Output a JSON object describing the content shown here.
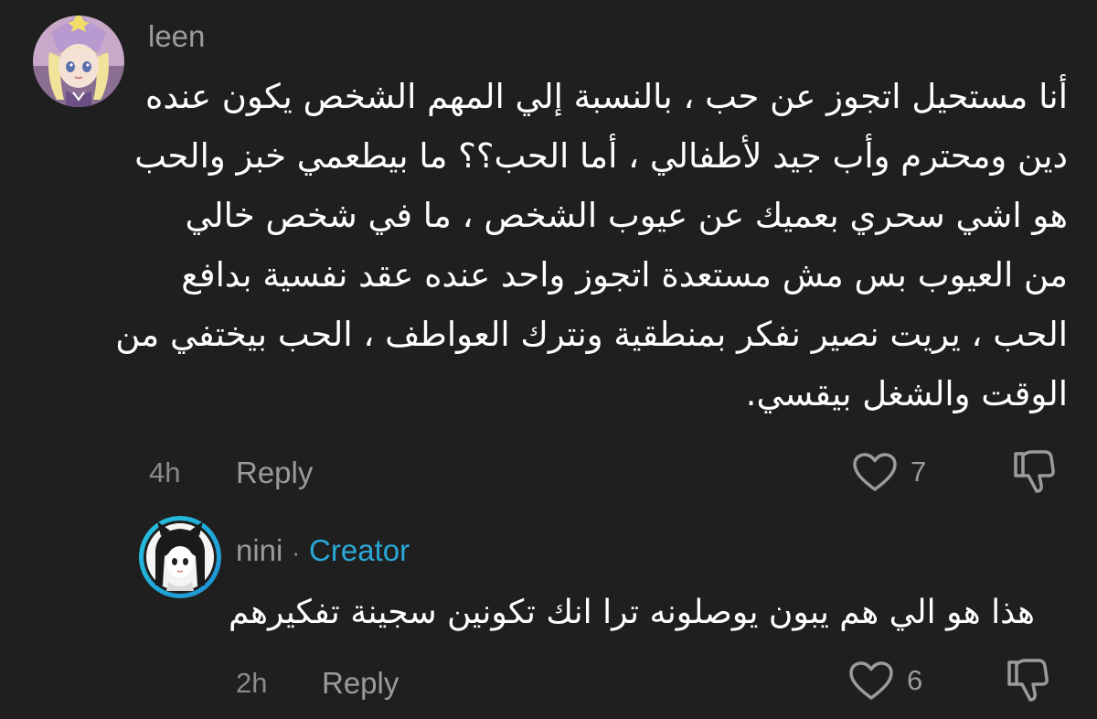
{
  "comments": [
    {
      "username": "leen",
      "avatar_icon": "anime-character-avatar",
      "text_lines": [
        "أنا مستحيل اتجوز عن حب ، بالنسبة إلي المهم الشخص يكون عنده",
        "دين ومحترم وأب جيد لأطفالي ، أما الحب؟؟ ما بيطعمي خبز والحب",
        "هو اشي سحري بعميك عن عيوب الشخص ، ما في شخص خالي",
        "من العيوب بس مش مستعدة اتجوز واحد عنده عقد نفسية بدافع",
        "الحب ، يريت نصير نفكر بمنطقية ونترك العواطف ، الحب بيختفي من",
        "الوقت والشغل بيقسي."
      ],
      "time": "4h",
      "reply_label": "Reply",
      "like_count": "7",
      "like_icon": "heart-icon",
      "dislike_icon": "thumbs-down-icon"
    },
    {
      "username": "nini",
      "separator": "·",
      "badge": "Creator",
      "avatar_icon": "anime-character-avatar",
      "text": "هذا هو الي هم يبون يوصلونه ترا انك تكونين سجينة تفكيرهم",
      "time": "2h",
      "reply_label": "Reply",
      "like_count": "6",
      "like_icon": "heart-icon",
      "dislike_icon": "thumbs-down-icon"
    }
  ],
  "colors": {
    "background": "#1f1f1f",
    "text": "#ffffff",
    "muted": "#9b9b9b",
    "creator_badge": "#2ba7d6"
  }
}
